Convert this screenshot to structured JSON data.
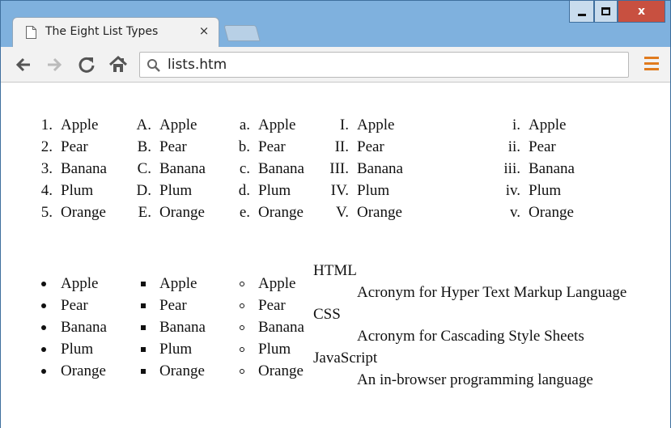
{
  "browser": {
    "tab_title": "The Eight List Types",
    "tab_close": "×",
    "address": "lists.htm",
    "window_close": "x"
  },
  "lists": {
    "decimal": {
      "markers": [
        "1.",
        "2.",
        "3.",
        "4.",
        "5."
      ],
      "items": [
        "Apple",
        "Pear",
        "Banana",
        "Plum",
        "Orange"
      ]
    },
    "upper_alpha": {
      "markers": [
        "A.",
        "B.",
        "C.",
        "D.",
        "E."
      ],
      "items": [
        "Apple",
        "Pear",
        "Banana",
        "Plum",
        "Orange"
      ]
    },
    "lower_alpha": {
      "markers": [
        "a.",
        "b.",
        "c.",
        "d.",
        "e."
      ],
      "items": [
        "Apple",
        "Pear",
        "Banana",
        "Plum",
        "Orange"
      ]
    },
    "upper_roman": {
      "markers": [
        "I.",
        "II.",
        "III.",
        "IV.",
        "V."
      ],
      "items": [
        "Apple",
        "Pear",
        "Banana",
        "Plum",
        "Orange"
      ]
    },
    "lower_roman": {
      "markers": [
        "i.",
        "ii.",
        "iii.",
        "iv.",
        "v."
      ],
      "items": [
        "Apple",
        "Pear",
        "Banana",
        "Plum",
        "Orange"
      ]
    },
    "disc": {
      "items": [
        "Apple",
        "Pear",
        "Banana",
        "Plum",
        "Orange"
      ]
    },
    "square": {
      "items": [
        "Apple",
        "Pear",
        "Banana",
        "Plum",
        "Orange"
      ]
    },
    "circle": {
      "items": [
        "Apple",
        "Pear",
        "Banana",
        "Plum",
        "Orange"
      ]
    },
    "definitions": [
      {
        "term": "HTML",
        "definition": "Acronym for Hyper Text Markup Language"
      },
      {
        "term": "CSS",
        "definition": "Acronym for Cascading Style Sheets"
      },
      {
        "term": "JavaScript",
        "definition": "An in-browser programming language"
      }
    ]
  }
}
